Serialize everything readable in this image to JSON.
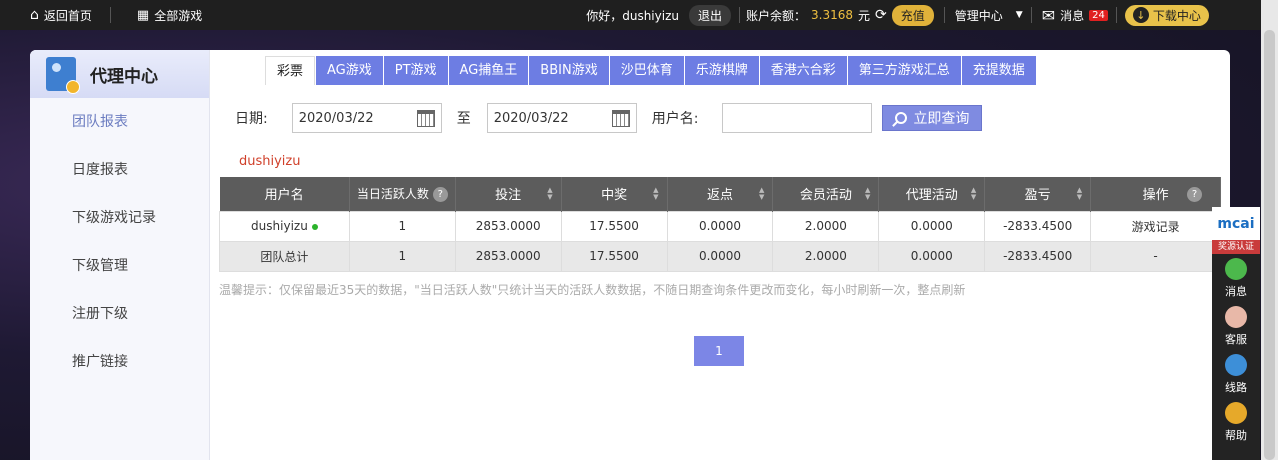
{
  "topbar": {
    "home": "返回首页",
    "all_games": "全部游戏",
    "greeting": "你好，dushiyizu",
    "logout": "退出",
    "balance_label": "账户余额：",
    "balance_value": "3.3168",
    "balance_unit": "元",
    "recharge": "充值",
    "manage": "管理中心",
    "messages": "消息",
    "message_count": "24",
    "download": "下载中心"
  },
  "sidebar": {
    "title": "代理中心",
    "items": [
      {
        "label": "团队报表",
        "active": true
      },
      {
        "label": "日度报表"
      },
      {
        "label": "下级游戏记录"
      },
      {
        "label": "下级管理"
      },
      {
        "label": "注册下级"
      },
      {
        "label": "推广链接"
      }
    ]
  },
  "tabs": [
    "彩票",
    "AG游戏",
    "PT游戏",
    "AG捕鱼王",
    "BBIN游戏",
    "沙巴体育",
    "乐游棋牌",
    "香港六合彩",
    "第三方游戏汇总",
    "充提数据"
  ],
  "filters": {
    "date_label": "日期:",
    "start_date": "2020/03/22",
    "to_label": "至",
    "end_date": "2020/03/22",
    "user_label": "用户名:",
    "user_value": "",
    "query_button": "立即查询"
  },
  "current_user": "dushiyizu",
  "table": {
    "headers": [
      "用户名",
      "当日活跃人数",
      "投注",
      "中奖",
      "返点",
      "会员活动",
      "代理活动",
      "盈亏",
      "操作"
    ],
    "rows": [
      [
        "dushiyizu",
        "1",
        "2853.0000",
        "17.5500",
        "0.0000",
        "2.0000",
        "0.0000",
        "-2833.4500",
        "游戏记录"
      ],
      [
        "团队总计",
        "1",
        "2853.0000",
        "17.5500",
        "0.0000",
        "2.0000",
        "0.0000",
        "-2833.4500",
        "-"
      ]
    ]
  },
  "tip": "温馨提示：仅保留最近35天的数据，\"当日活跃人数\"只统计当天的活跃人数数据，不随日期查询条件更改而变化，每小时刷新一次，整点刷新",
  "pager": {
    "current": "1"
  },
  "right_bar": {
    "logo": "mcai",
    "cert": "奖源认证",
    "items": [
      "消息",
      "客服",
      "线路",
      "帮助"
    ]
  },
  "colors": {
    "accent": "#6d7de3",
    "header_bg": "#5c5c5c",
    "highlight": "#d0402a"
  }
}
